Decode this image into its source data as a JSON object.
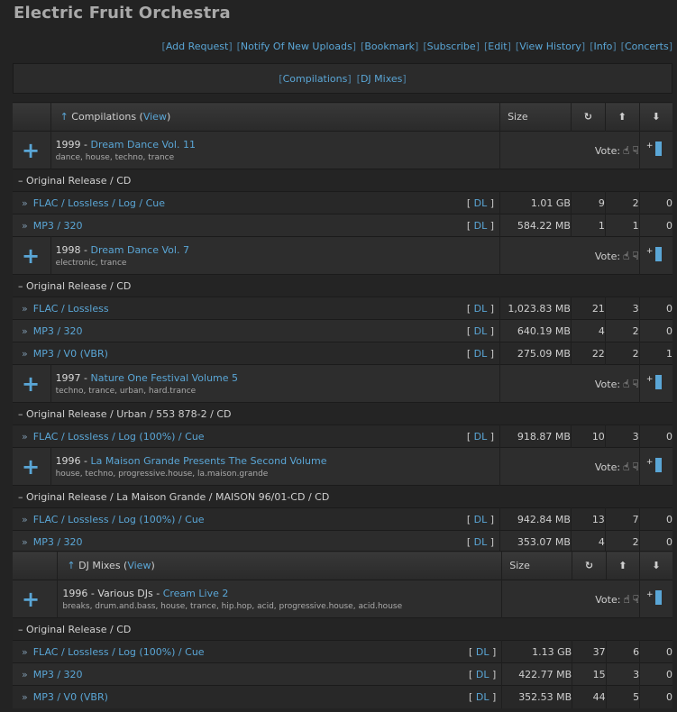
{
  "title": "Electric Fruit Orchestra",
  "links": [
    "Add Request",
    "Notify Of New Uploads",
    "Bookmark",
    "Subscribe",
    "Edit",
    "View History",
    "Info",
    "Concerts"
  ],
  "categories": [
    "Compilations",
    "DJ Mixes"
  ],
  "labels": {
    "view": "View",
    "size": "Size",
    "vote": "Vote:",
    "dl": "DL",
    "raquo": "»",
    "plus": "+",
    "up_arrow": "↑",
    "snatched_icon": "↻",
    "seeders_icon": "⬆",
    "leechers_icon": "⬇",
    "thumb_up": "👍",
    "thumb_down": "👎"
  },
  "sections": [
    {
      "name": "Compilations",
      "groups": [
        {
          "year": "1999",
          "artist": "",
          "album": "Dream Dance Vol. 11",
          "tags": "dance, house, techno, trance",
          "editions": [
            {
              "name": "Original Release / CD",
              "torrents": [
                {
                  "format": "FLAC / Lossless / Log / Cue",
                  "size": "1.01 GB",
                  "snatched": "9",
                  "seeders": "2",
                  "leechers": "0"
                },
                {
                  "format": "MP3 / 320",
                  "size": "584.22 MB",
                  "snatched": "1",
                  "seeders": "1",
                  "leechers": "0"
                }
              ]
            }
          ]
        },
        {
          "year": "1998",
          "artist": "",
          "album": "Dream Dance Vol. 7",
          "tags": "electronic, trance",
          "editions": [
            {
              "name": "Original Release / CD",
              "torrents": [
                {
                  "format": "FLAC / Lossless",
                  "size": "1,023.83 MB",
                  "snatched": "21",
                  "seeders": "3",
                  "leechers": "0"
                },
                {
                  "format": "MP3 / 320",
                  "size": "640.19 MB",
                  "snatched": "4",
                  "seeders": "2",
                  "leechers": "0"
                },
                {
                  "format": "MP3 / V0 (VBR)",
                  "size": "275.09 MB",
                  "snatched": "22",
                  "seeders": "2",
                  "leechers": "1"
                }
              ]
            }
          ]
        },
        {
          "year": "1997",
          "artist": "",
          "album": "Nature One Festival Volume 5",
          "tags": "techno, trance, urban, hard.trance",
          "editions": [
            {
              "name": "Original Release / Urban / 553 878-2 / CD",
              "torrents": [
                {
                  "format": "FLAC / Lossless / Log (100%) / Cue",
                  "size": "918.87 MB",
                  "snatched": "10",
                  "seeders": "3",
                  "leechers": "0"
                }
              ]
            }
          ]
        },
        {
          "year": "1996",
          "artist": "",
          "album": "La Maison Grande Presents The Second Volume",
          "tags": "house, techno, progressive.house, la.maison.grande",
          "editions": [
            {
              "name": "Original Release / La Maison Grande / MAISON 96/01-CD / CD",
              "torrents": [
                {
                  "format": "FLAC / Lossless / Log (100%) / Cue",
                  "size": "942.84 MB",
                  "snatched": "13",
                  "seeders": "7",
                  "leechers": "0"
                },
                {
                  "format": "MP3 / 320",
                  "size": "353.07 MB",
                  "snatched": "4",
                  "seeders": "2",
                  "leechers": "0"
                }
              ]
            }
          ]
        }
      ]
    },
    {
      "name": "DJ Mixes",
      "groups": [
        {
          "year": "1996",
          "artist": "Various DJs",
          "album": "Cream Live 2",
          "tags": "breaks, drum.and.bass, house, trance, hip.hop, acid, progressive.house, acid.house",
          "editions": [
            {
              "name": "Original Release / CD",
              "torrents": [
                {
                  "format": "FLAC / Lossless / Log (100%) / Cue",
                  "size": "1.13 GB",
                  "snatched": "37",
                  "seeders": "6",
                  "leechers": "0"
                },
                {
                  "format": "MP3 / 320",
                  "size": "422.77 MB",
                  "snatched": "15",
                  "seeders": "3",
                  "leechers": "0"
                },
                {
                  "format": "MP3 / V0 (VBR)",
                  "size": "352.53 MB",
                  "snatched": "44",
                  "seeders": "5",
                  "leechers": "0"
                }
              ]
            }
          ]
        }
      ]
    }
  ],
  "colors": {
    "link": "#5aa6d6",
    "background": "#232323",
    "title": "#a9a9a9"
  }
}
